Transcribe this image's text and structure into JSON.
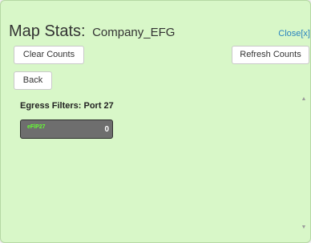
{
  "header": {
    "title": "Map Stats:",
    "company": "Company_EFG",
    "close_label": "Close[x]"
  },
  "toolbar": {
    "clear_counts_label": "Clear Counts",
    "refresh_counts_label": "Refresh Counts",
    "back_label": "Back"
  },
  "content": {
    "section_title": "Egress Filters: Port 27",
    "stats": [
      {
        "label": "eFlP27",
        "value": "0"
      }
    ]
  },
  "scrollbar": {
    "up_icon": "▲",
    "down_icon": "▼"
  },
  "colors": {
    "panel_bg": "#d8f7c8",
    "link": "#2b84bf",
    "tile_bg": "#6e6e6e",
    "tile_label": "#66ff33"
  }
}
